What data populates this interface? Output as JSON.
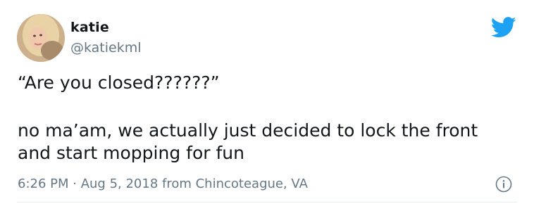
{
  "user": {
    "display_name": "katie",
    "handle": "@katiekml"
  },
  "tweet": {
    "line_1": "“Are you closed??????”",
    "line_2": "no ma’am, we actually just decided to lock the front and start mopping for fun"
  },
  "meta": {
    "time": "6:26 PM",
    "separator": " · ",
    "date": "Aug 5, 2018",
    "location_text": " from Chincoteague, VA"
  },
  "icons": {
    "brand": "twitter-bird-icon",
    "info": "info-icon"
  },
  "colors": {
    "brand_blue": "#1da1f2",
    "text": "#14171a",
    "secondary_text": "#657786"
  }
}
